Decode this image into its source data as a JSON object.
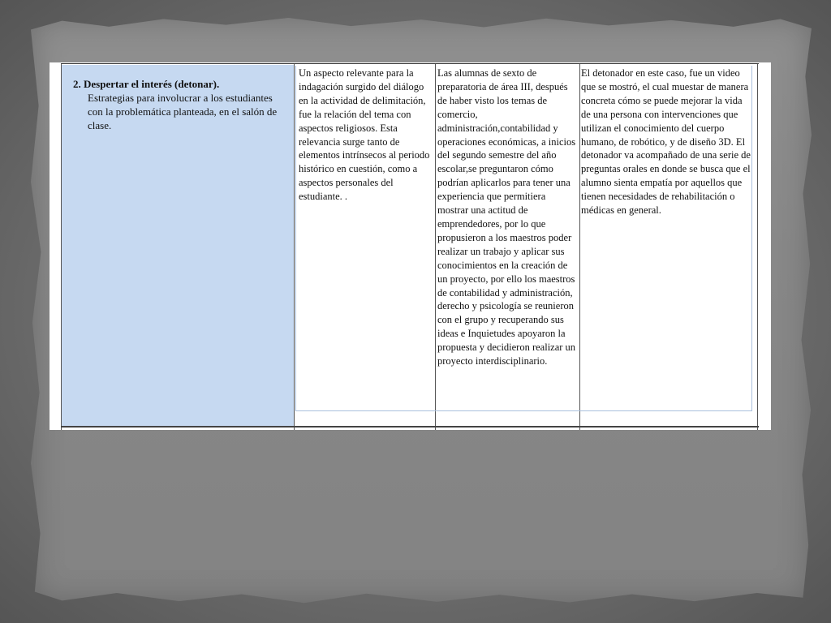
{
  "row": {
    "criterion": {
      "title": "2. Despertar el interés (detonar).",
      "description": "Estrategias para involucrar a los estudiantes con la problemática planteada, en el salón de clase."
    },
    "cells": [
      "Un aspecto relevante para la indagación surgido del diálogo en la actividad de delimitación, fue la relación del tema con aspectos religiosos. Esta relevancia surge tanto de elementos intrínsecos al periodo histórico en cuestión, como a aspectos personales del estudiante. .",
      "Las alumnas de sexto de preparatoria de área III, después de haber visto los temas de comercio, administración,contabilidad y operaciones económicas, a inicios del segundo semestre del año escolar,se preguntaron cómo podrían aplicarlos para tener una experiencia que permitiera mostrar una actitud de emprendedores, por lo que propusieron a los maestros poder realizar un trabajo y aplicar sus conocimientos en la creación de un proyecto, por ello los maestros de contabilidad y administración, derecho y psicología se reunieron con el grupo y recuperando sus ideas e Inquietudes apoyaron la propuesta y decidieron realizar un proyecto interdisciplinario.",
      "El detonador en este caso, fue un video que se mostró, el cual muestar de manera concreta cómo se puede mejorar la vida de una persona con intervenciones que utilizan el conocimiento del cuerpo humano, de robótico, y de diseño 3D. El detonador va acompañado de una serie de preguntas orales en donde se busca que el alumno sienta empatía por aquellos que tienen necesidades de rehabilitación o médicas en general."
    ]
  }
}
